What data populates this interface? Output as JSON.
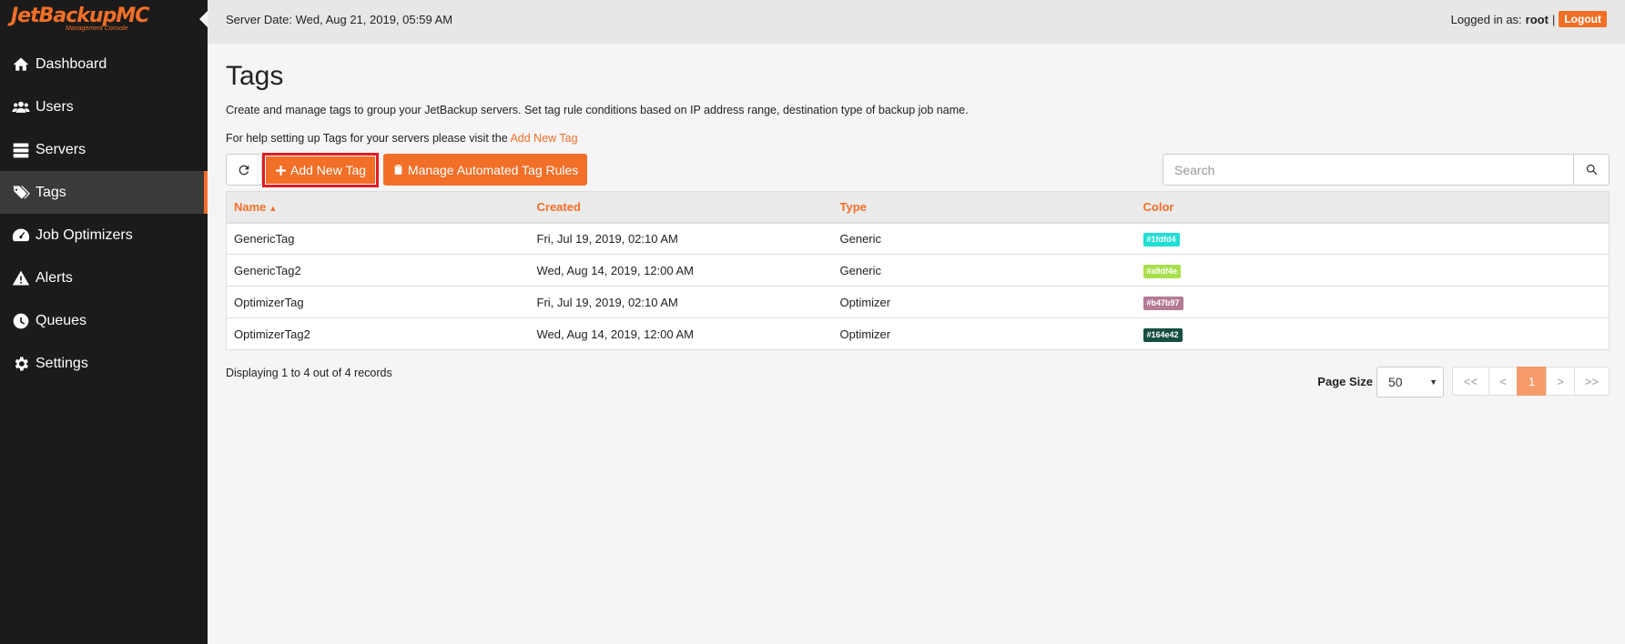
{
  "brand": {
    "name": "JetBackupMC",
    "subtitle": "Management Console"
  },
  "sidebar": {
    "items": [
      {
        "label": "Dashboard",
        "icon": "home-icon"
      },
      {
        "label": "Users",
        "icon": "users-icon"
      },
      {
        "label": "Servers",
        "icon": "servers-icon"
      },
      {
        "label": "Tags",
        "icon": "tags-icon",
        "active": true
      },
      {
        "label": "Job Optimizers",
        "icon": "gauge-icon"
      },
      {
        "label": "Alerts",
        "icon": "warning-icon"
      },
      {
        "label": "Queues",
        "icon": "clock-icon"
      },
      {
        "label": "Settings",
        "icon": "gear-icon"
      }
    ]
  },
  "topbar": {
    "server_date": "Server Date: Wed, Aug 21, 2019, 05:59 AM",
    "logged_in_label": "Logged in as:",
    "username": "root",
    "separator": "|",
    "logout_label": "Logout"
  },
  "main": {
    "title": "Tags",
    "description": "Create and manage tags to group your JetBackup servers. Set tag rule conditions based on IP address range, destination type of backup job name.",
    "help_text": "For help setting up Tags for your servers please visit the",
    "help_link": "Add New Tag"
  },
  "toolbar": {
    "add_label": "Add New Tag",
    "manage_label": "Manage Automated Tag Rules",
    "search_placeholder": "Search"
  },
  "table": {
    "columns": [
      "Name",
      "Created",
      "Type",
      "Color"
    ],
    "sort_indicator": "▲",
    "rows": [
      {
        "name": "GenericTag",
        "created": "Fri, Jul 19, 2019, 02:10 AM",
        "type": "Generic",
        "color": "#1fdfd4"
      },
      {
        "name": "GenericTag2",
        "created": "Wed, Aug 14, 2019, 12:00 AM",
        "type": "Generic",
        "color": "#a9df4e"
      },
      {
        "name": "OptimizerTag",
        "created": "Fri, Jul 19, 2019, 02:10 AM",
        "type": "Optimizer",
        "color": "#b47b97"
      },
      {
        "name": "OptimizerTag2",
        "created": "Wed, Aug 14, 2019, 12:00 AM",
        "type": "Optimizer",
        "color": "#164e42"
      }
    ]
  },
  "footer": {
    "records_text": "Displaying 1 to 4 out of 4 records",
    "page_size_label": "Page Size",
    "page_size_value": "50",
    "pager": {
      "first": "<<",
      "prev": "<",
      "current": "1",
      "next": ">",
      "last": ">>"
    }
  },
  "colors": {
    "accent": "#f26f28",
    "sidebar_bg": "#1b1b1b",
    "highlight_border": "#e31b23"
  }
}
